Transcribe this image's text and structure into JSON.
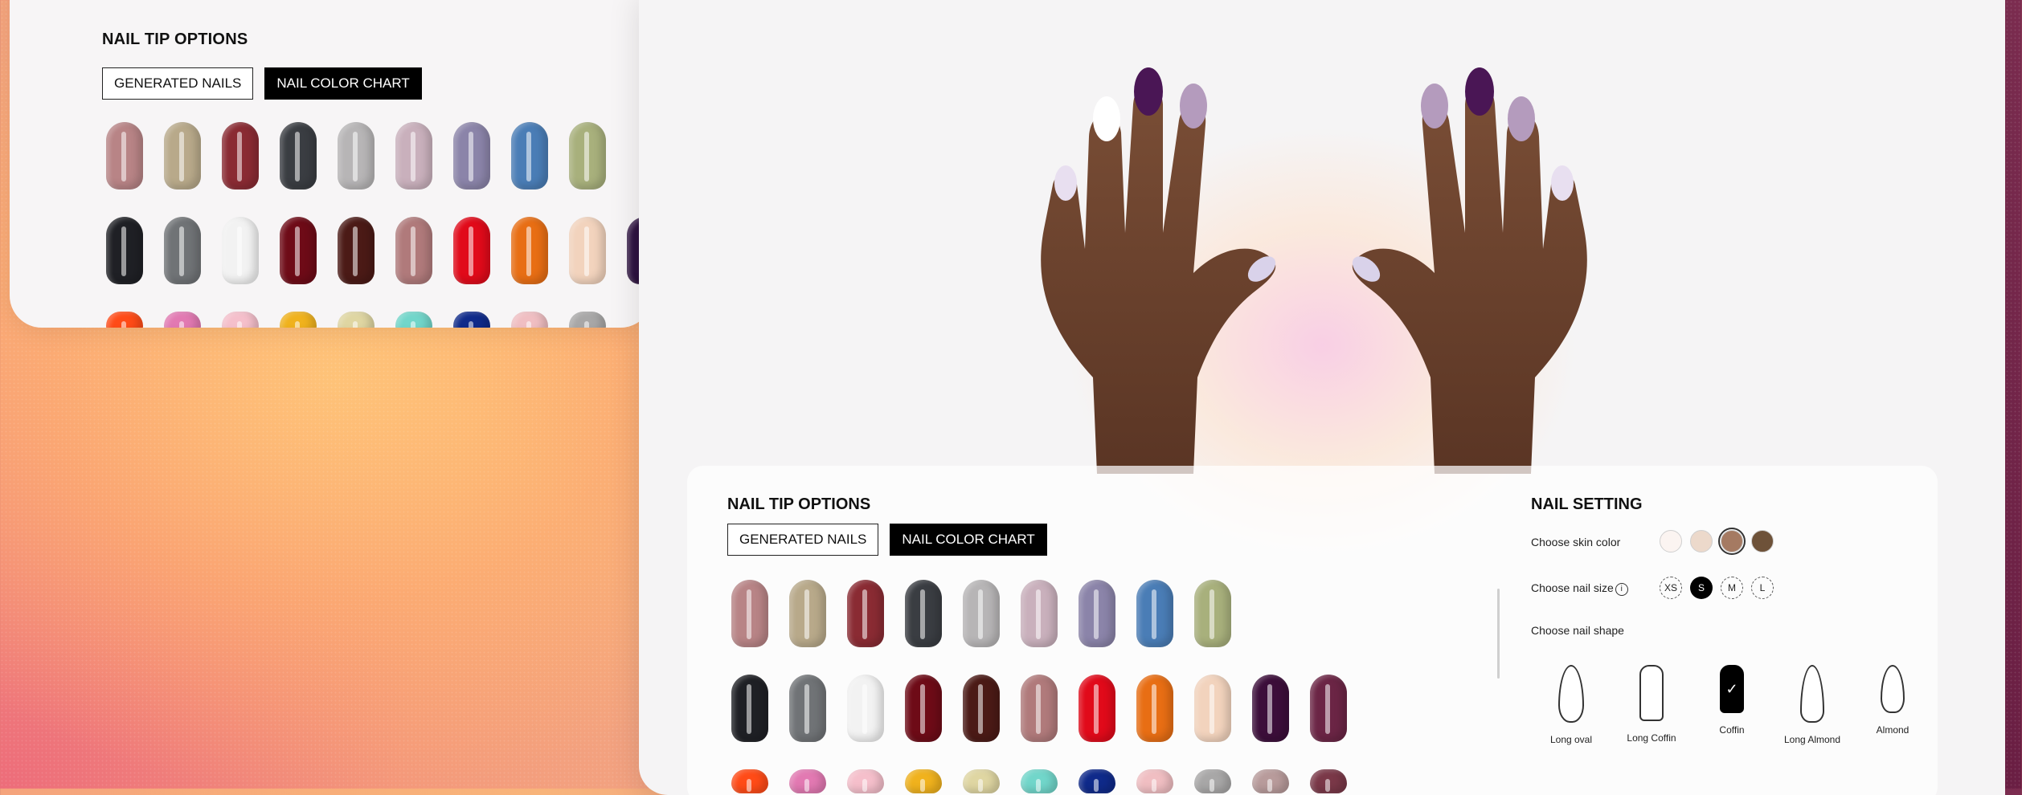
{
  "back_panel": {
    "title": "NAIL TIP OPTIONS",
    "tabs": [
      "GENERATED NAILS",
      "NAIL COLOR CHART"
    ],
    "rows": [
      [
        "#b88486",
        "#b8a98a",
        "#8a2b33",
        "#3a3d42",
        "#b7b5b6",
        "#c9b0bc",
        "#8b84a9",
        "#4a7db6",
        "#a8b07c",
        null,
        null
      ],
      [
        "#1f2025",
        "#707376",
        "#f2f2f2",
        "#6e0b17",
        "#4b1a16",
        "#b07a7b",
        "#e10a1a",
        "#e86e14",
        "#f2d3bd",
        "#2e1240",
        null
      ],
      [
        "#ff4b17",
        "#e279b2",
        "#f5bfcb",
        "#f0b21d",
        "#dfd6a2",
        "#71d6ca",
        "#0f2a8a",
        "#f0bec2",
        "#a8a7a7",
        null,
        null
      ]
    ]
  },
  "main": {
    "caption": "",
    "nail_panel": {
      "title": "NAIL TIP OPTIONS",
      "tabs": [
        "GENERATED NAILS",
        "NAIL COLOR CHART"
      ],
      "rows": [
        [
          "#b88486",
          "#b8a98a",
          "#8a2b33",
          "#3a3d42",
          "#b7b5b6",
          "#c9b0bc",
          "#8b84a9",
          "#4a7db6",
          "#a8b07c",
          null,
          null
        ],
        [
          "#1f2025",
          "#707376",
          "#f2f2f2",
          "#6e0b17",
          "#4b1a16",
          "#b07a7b",
          "#e10a1a",
          "#e86e14",
          "#f2d3bd",
          "#3c0e3a",
          "#6b2545"
        ],
        [
          "#ff4b17",
          "#e279b2",
          "#f5bfcb",
          "#f0b21d",
          "#dfd6a2",
          "#71d6ca",
          "#0f2a8a",
          "#f0bec2",
          "#a8a7a7",
          "#b89b9b",
          "#7a3848"
        ]
      ]
    },
    "settings": {
      "title": "NAIL SETTING",
      "skin_label": "Choose skin color",
      "skin_colors": [
        "#fbf4f1",
        "#ecd9cb",
        "#a57a62",
        "#6e5239"
      ],
      "selected_skin_index": 2,
      "size_label": "Choose nail size",
      "sizes": [
        "XS",
        "S",
        "M",
        "L"
      ],
      "active_size": "S",
      "shape_label": "Choose nail shape",
      "shapes": [
        "Long oval",
        "Long Coffin",
        "Coffin",
        "Long Almond",
        "Almond"
      ],
      "active_shape": "Coffin",
      "check_mark": "✓"
    }
  },
  "colors": {
    "accent": "#000000",
    "panel_bg": "#f5f4f5",
    "skin_tone": "#6b4430"
  }
}
